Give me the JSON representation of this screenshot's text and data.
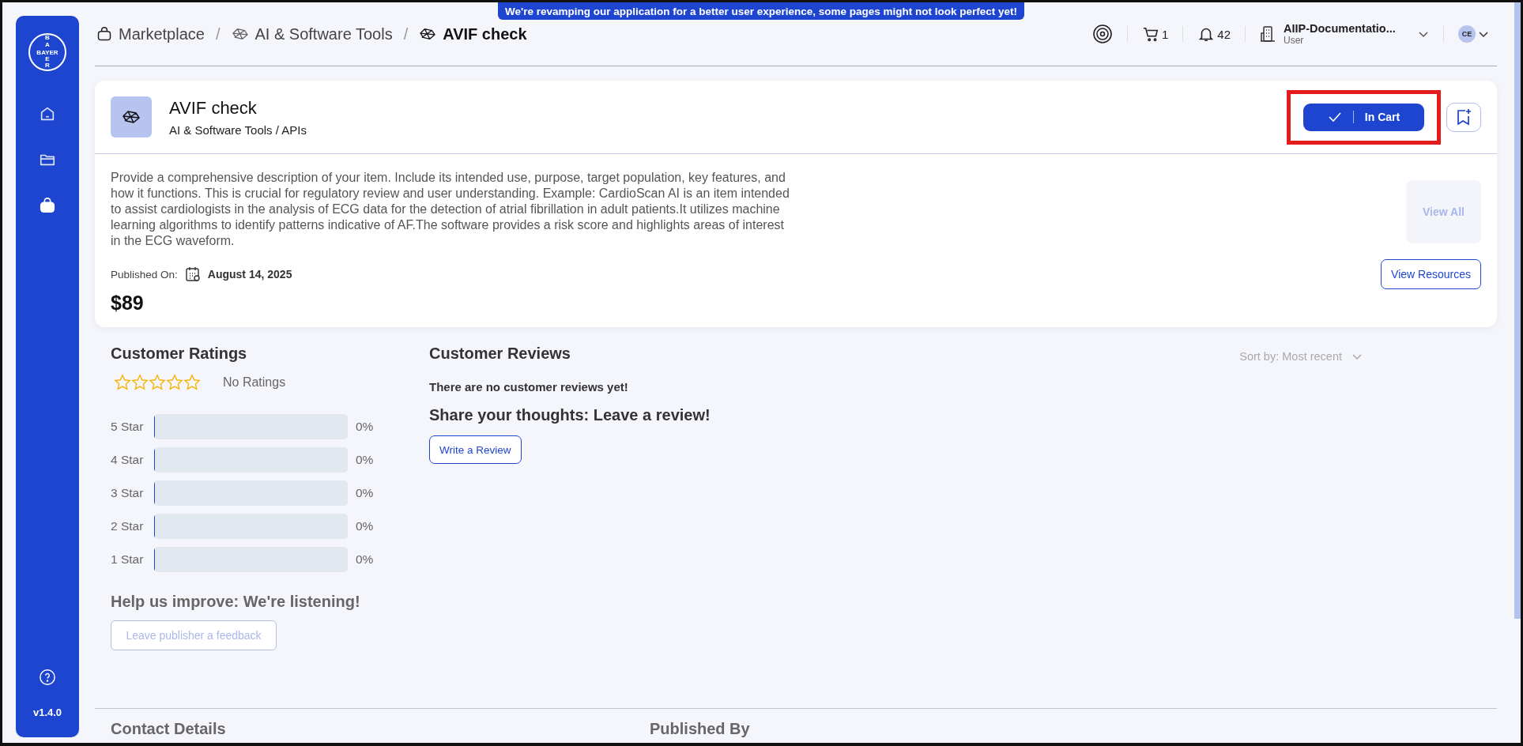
{
  "banner": {
    "text": "We're revamping our application for a better user experience, some pages might not look perfect yet!"
  },
  "sidebar": {
    "logo": {
      "top": "BA",
      "word": "BAYER",
      "bottom": "ER"
    },
    "nav": [
      {
        "kind": "home",
        "selected": false
      },
      {
        "kind": "folder",
        "selected": false
      },
      {
        "kind": "bag",
        "selected": true
      }
    ],
    "version": "v1.4.0"
  },
  "breadcrumb": [
    {
      "label": "Marketplace",
      "kind": "bag",
      "selected": false
    },
    {
      "separator": "/",
      "label": "AI & Software Tools",
      "kind": "mesh",
      "selected": false
    },
    {
      "separator": "/",
      "label": "AVIF check",
      "kind": "mesh",
      "selected": true
    }
  ],
  "topbar": {
    "cart_count": "1",
    "notification_count": "42",
    "org": {
      "name": "AIIP-Documentatio...",
      "role": "User"
    },
    "avatar": "CE"
  },
  "product": {
    "title": "AVIF check",
    "category": "AI & Software Tools / APIs",
    "description": "Provide a comprehensive description of your item. Include its intended use, purpose, target population, key features, and how it functions. This is crucial for regulatory review and user understanding. Example: CardioScan AI is an item intended to assist cardiologists in the analysis of ECG data for the detection of atrial fibrillation in adult patients.It utilizes machine learning algorithms to identify patterns indicative of AF.The software provides a risk score and highlights areas of interest in the ECG waveform.",
    "published_label": "Published On:",
    "published_date": "August 14, 2025",
    "price": "$89",
    "cart_button": {
      "label": "In Cart",
      "in_cart": true,
      "highlighted": true
    },
    "view_all": {
      "label": "View All",
      "disabled": true
    },
    "view_resources": {
      "label": "View Resources"
    }
  },
  "ratings": {
    "title": "Customer Ratings",
    "stars": 0,
    "summary": "No Ratings",
    "bars": [
      {
        "label": "5 Star",
        "level": 0,
        "percent": "0%"
      },
      {
        "label": "4 Star",
        "level": 0,
        "percent": "0%"
      },
      {
        "label": "3 Star",
        "level": 0,
        "percent": "0%"
      },
      {
        "label": "2 Star",
        "level": 0,
        "percent": "0%"
      },
      {
        "label": "1 Star",
        "level": 0,
        "percent": "0%"
      }
    ],
    "improve_title": "Help us improve: We're listening!",
    "feedback_button": {
      "label": "Leave publisher a feedback",
      "disabled": true
    }
  },
  "reviews": {
    "title": "Customer Reviews",
    "sort": "Sort by: Most recent",
    "empty": "There are no customer reviews yet!",
    "prompt": "Share your thoughts: Leave a review!",
    "write_button": "Write a Review"
  },
  "footer_sections": [
    "Contact Details",
    "Published By"
  ]
}
